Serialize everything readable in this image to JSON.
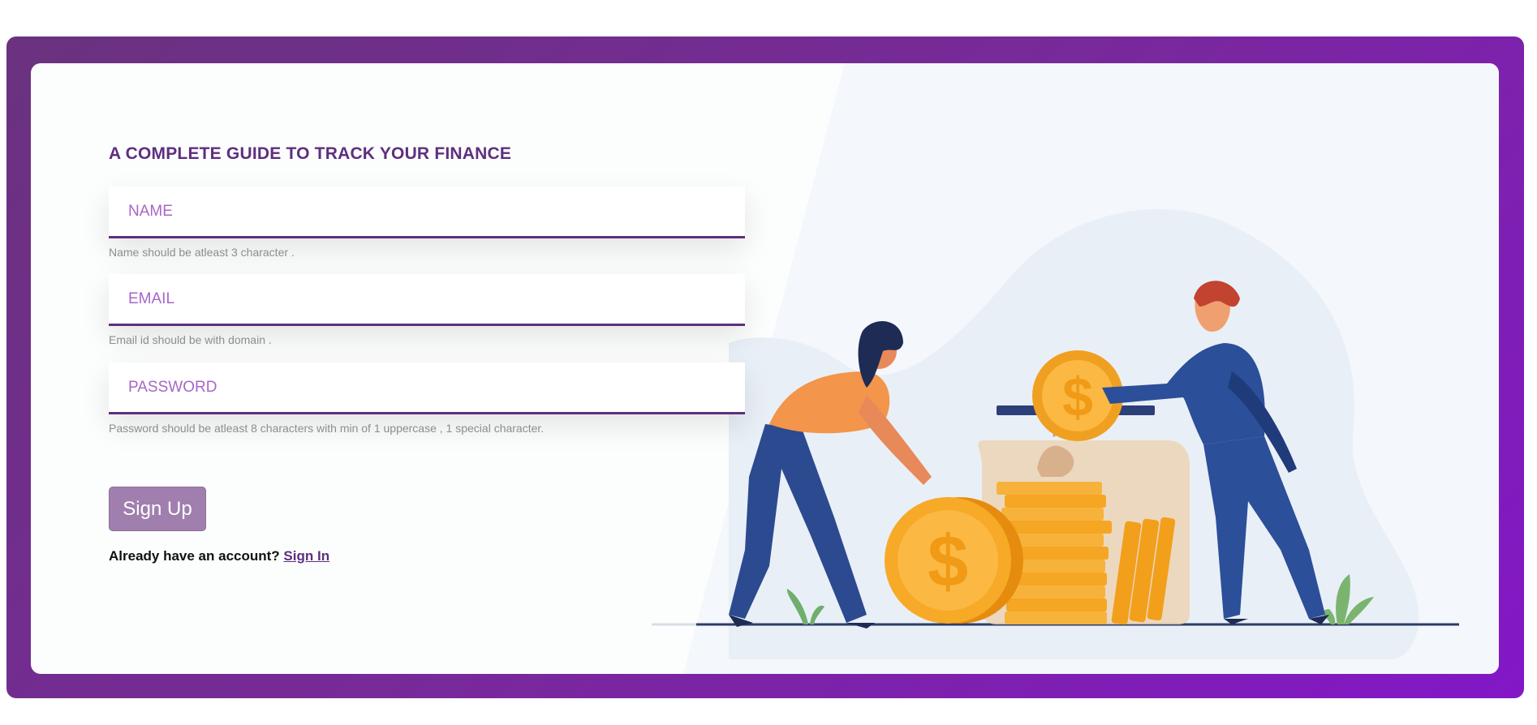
{
  "form": {
    "title": "A COMPLETE GUIDE TO TRACK YOUR FINANCE",
    "name": {
      "placeholder": "NAME",
      "value": "",
      "hint": "Name should be atleast 3 character ."
    },
    "email": {
      "placeholder": "EMAIL",
      "value": "",
      "hint": "Email id should be with domain ."
    },
    "password": {
      "placeholder": "PASSWORD",
      "value": "",
      "hint": "Password should be atleast 8 characters with min of 1 uppercase , 1 special character."
    },
    "signup_label": "Sign Up",
    "account_prompt": "Already have an account?",
    "signin_label": "Sign In"
  },
  "colors": {
    "accent": "#5e2f7e",
    "frame_gradient_start": "#6a327f",
    "frame_gradient_end": "#8317c7",
    "button": "#a07fae",
    "placeholder": "#a866c8"
  },
  "illustration": {
    "icon": "savings-jar-coins-illustration"
  }
}
